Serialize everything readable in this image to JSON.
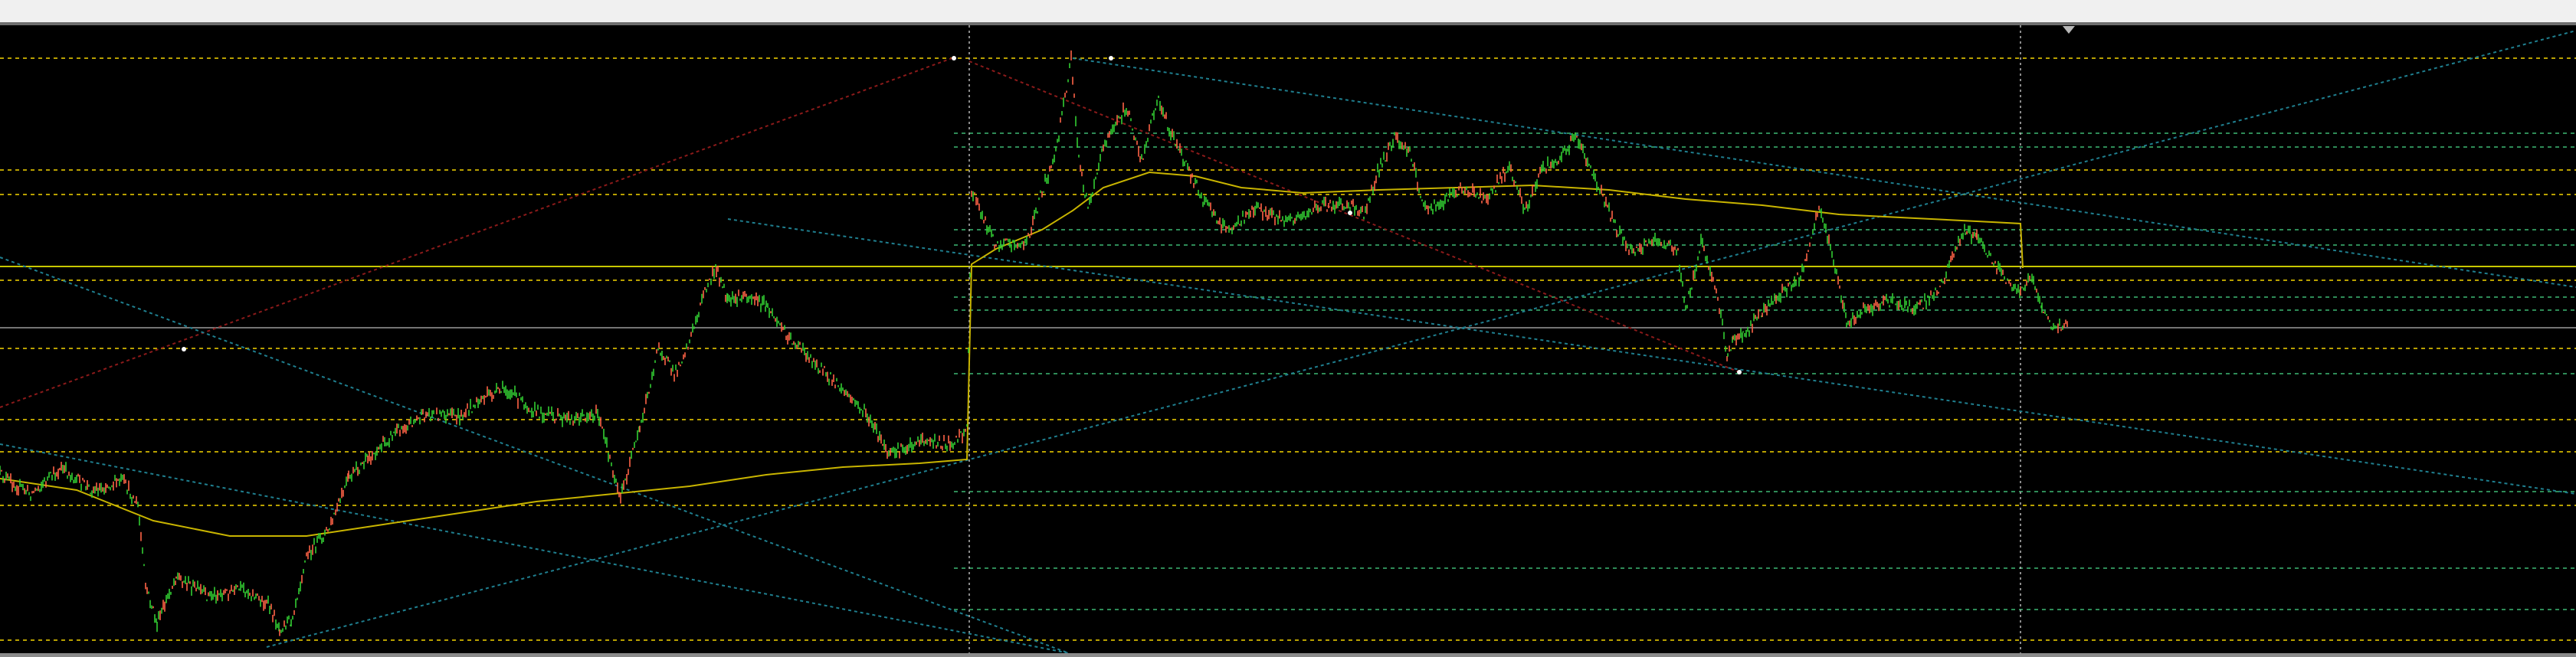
{
  "window": {
    "toolbar_background": "#f0f0f0"
  },
  "chart": {
    "background": "#000000",
    "candle_up_color": "#32cd32",
    "candle_down_color": "#ff6347",
    "moving_average_color": "#c8b400",
    "level_line_color_green": "#2e8b57",
    "level_line_color_yellow": "#b8a000",
    "trend_line_color_teal": "#1f7f8f",
    "trend_line_color_red": "#8b1a1a",
    "horizontal_line_color": "#c8c800",
    "separator_color": "#b8b8b8",
    "icons": [
      "chart-shift-marker-icon"
    ]
  }
}
